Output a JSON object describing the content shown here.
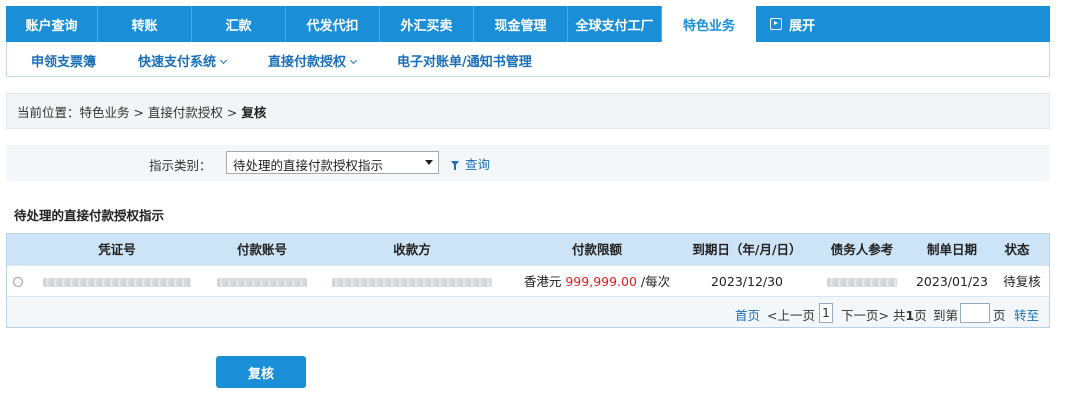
{
  "topnav": {
    "tabs": [
      "账户查询",
      "转账",
      "汇款",
      "代发代扣",
      "外汇买卖",
      "现金管理",
      "全球支付工厂",
      "特色业务"
    ],
    "active_index": 7,
    "expand_label": "展开"
  },
  "subnav": {
    "items": [
      {
        "label": "申领支票簿"
      },
      {
        "label": "快速支付系统"
      },
      {
        "label": "直接付款授权"
      },
      {
        "label": "电子对账单/通知书管理"
      }
    ]
  },
  "breadcrumb": {
    "prefix": "当前位置：",
    "path": "特色业务 > 直接付款授权 > ",
    "current": "复核"
  },
  "filter": {
    "label": "指示类别：",
    "selected": "待处理的直接付款授权指示",
    "query_label": "查询"
  },
  "section_title": "待处理的直接付款授权指示",
  "table": {
    "headers": [
      "凭证号",
      "付款账号",
      "收款方",
      "付款限额",
      "到期日（年/月/日）",
      "债务人参考",
      "制单日期",
      "状态"
    ],
    "rows": [
      {
        "currency": "香港元",
        "amount": "999,999.00",
        "per": "/每次",
        "expiry": "2023/12/30",
        "created": "2023/01/23",
        "status": "待复核"
      }
    ]
  },
  "pager": {
    "first": "首页",
    "prev": "<上一页",
    "current_page": "1",
    "next": "下一页>",
    "total_prefix": "共",
    "total": "1",
    "total_suffix": "页",
    "goto_prefix": "到第",
    "goto_suffix": "页",
    "goto": "转至"
  },
  "submit_label": "复核",
  "colors": {
    "primary": "#1a8fd8",
    "link": "#1a6fb8",
    "amount": "#e01e1e",
    "table_header": "#cde3f6"
  }
}
